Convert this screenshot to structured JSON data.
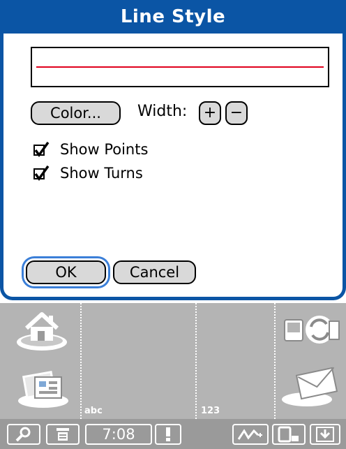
{
  "dialog": {
    "title": "Line Style",
    "preview_line_color": "#e0001c",
    "color_button_label": "Color...",
    "width_label": "Width:",
    "width_plus_label": "+",
    "width_minus_label": "−",
    "show_points": {
      "label": "Show Points",
      "checked": true
    },
    "show_turns": {
      "label": "Show Turns",
      "checked": true
    },
    "ok_label": "OK",
    "cancel_label": "Cancel",
    "accent_color": "#0b55a5"
  },
  "silkscreen": {
    "abc_label": "abc",
    "num_label": "123",
    "icons": [
      "home-icon",
      "applications-icon",
      "sync-icon",
      "mail-icon"
    ]
  },
  "statusbar": {
    "time": "7:08",
    "icons": [
      "find-icon",
      "menu-icon",
      "alert-icon",
      "graffiti-icon",
      "input-area-icon",
      "hide-area-icon"
    ]
  }
}
